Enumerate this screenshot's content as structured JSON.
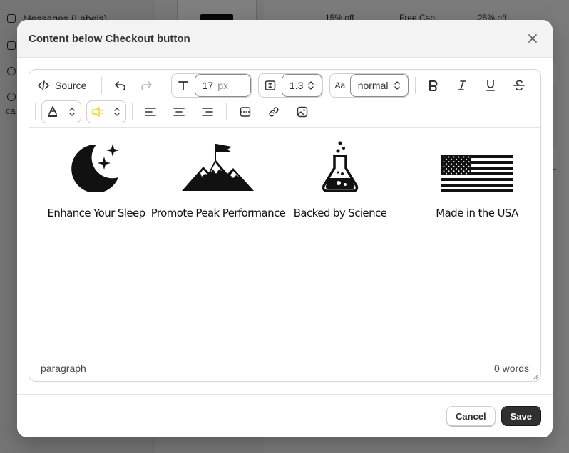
{
  "background": {
    "nav_items": [
      "Messages (Labels)"
    ],
    "nav_cut": "ca",
    "offers": [
      "15% off",
      "Free Cap",
      "25% off"
    ]
  },
  "modal": {
    "title": "Content below Checkout button"
  },
  "toolbar": {
    "source_label": "Source",
    "font_size_value": "17",
    "font_size_unit": "px",
    "line_height_value": "1.3",
    "font_weight_value": "normal",
    "font_weight_prefix": "Aa",
    "icons": [
      "code-icon",
      "undo-icon",
      "redo-icon",
      "text-size-icon",
      "line-height-icon",
      "bold-icon",
      "italic-icon",
      "underline-icon",
      "strikethrough-icon",
      "text-color-icon",
      "highlight-icon",
      "align-left-icon",
      "align-center-icon",
      "align-right-icon",
      "horizontal-rule-icon",
      "link-icon",
      "image-icon"
    ]
  },
  "features": [
    {
      "label": "Enhance Your Sleep",
      "icon": "moon-stars-icon"
    },
    {
      "label": "Promote Peak Performance",
      "icon": "mountain-flag-icon"
    },
    {
      "label": "Backed by Science",
      "icon": "flask-icon"
    },
    {
      "label": "Made in the USA",
      "icon": "usa-flag-icon"
    }
  ],
  "status": {
    "element": "paragraph",
    "word_count": "0 words"
  },
  "footer": {
    "cancel_label": "Cancel",
    "save_label": "Save"
  },
  "colors": {
    "primary_button": "#303030",
    "highlight_swatch": "#f2d22e"
  }
}
